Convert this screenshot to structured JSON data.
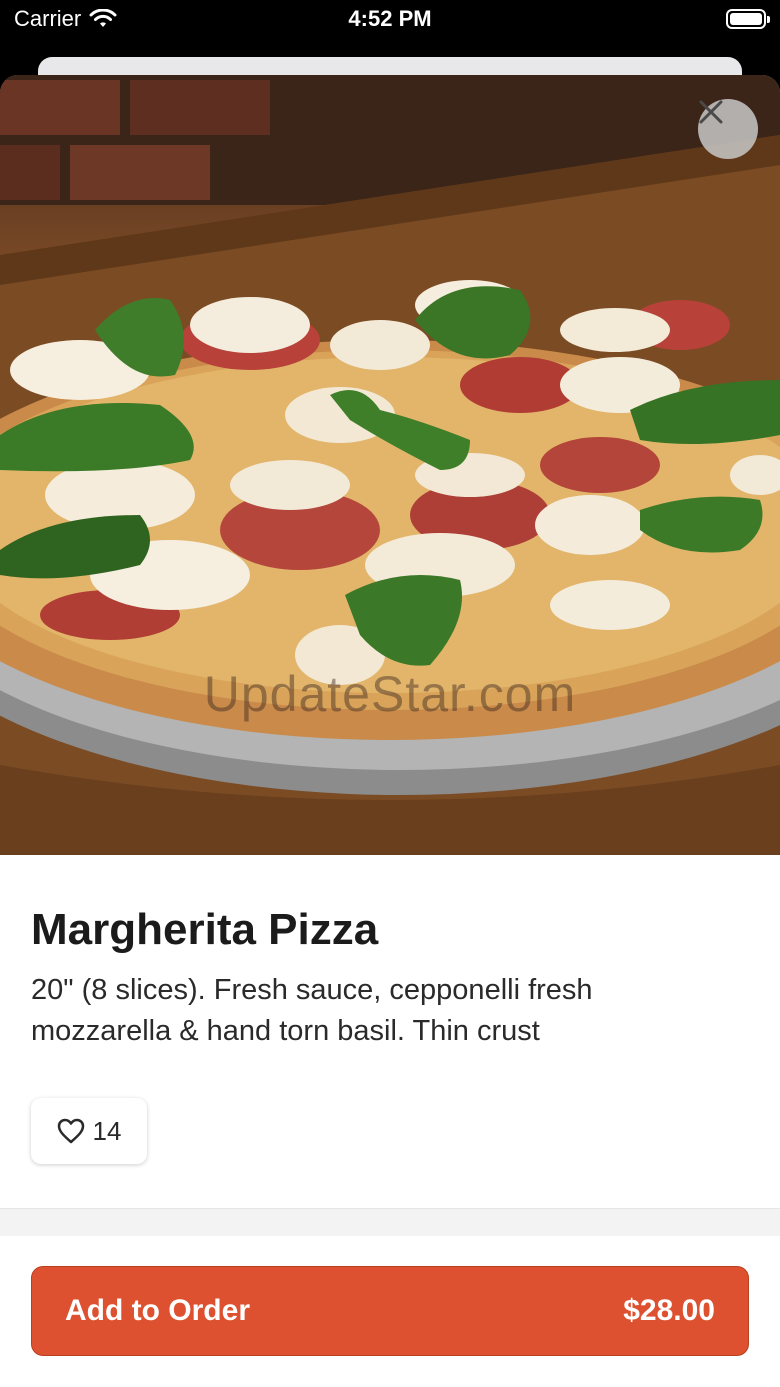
{
  "status_bar": {
    "carrier": "Carrier",
    "time": "4:52 PM"
  },
  "item": {
    "name": "Margherita Pizza",
    "description": "20\" (8 slices). Fresh sauce, cepponelli fresh mozzarella & hand torn basil. Thin crust",
    "likes": "14",
    "image_watermark": "UpdateStar.com"
  },
  "order": {
    "button_label": "Add to Order",
    "price": "$28.00"
  },
  "colors": {
    "accent": "#dd5130",
    "close_button_bg": "#c8c8c8"
  },
  "icons": {
    "close": "close-icon",
    "like": "heart-icon",
    "wifi": "wifi-icon",
    "battery": "battery-icon"
  }
}
